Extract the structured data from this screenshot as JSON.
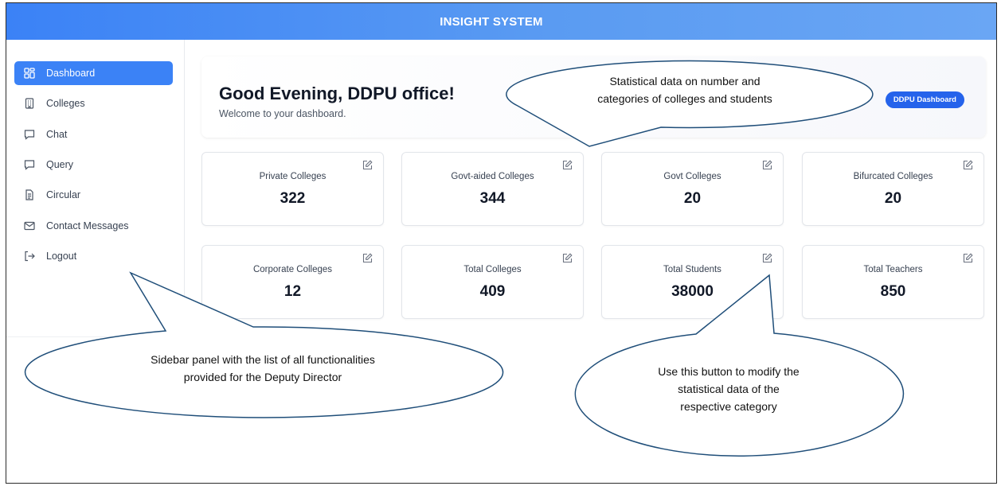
{
  "app": {
    "title": "INSIGHT SYSTEM"
  },
  "sidebar": {
    "items": [
      {
        "label": "Dashboard",
        "icon": "dashboard-icon",
        "active": true
      },
      {
        "label": "Colleges",
        "icon": "building-icon",
        "active": false
      },
      {
        "label": "Chat",
        "icon": "chat-icon",
        "active": false
      },
      {
        "label": "Query",
        "icon": "query-icon",
        "active": false
      },
      {
        "label": "Circular",
        "icon": "document-icon",
        "active": false
      },
      {
        "label": "Contact Messages",
        "icon": "mail-icon",
        "active": false
      },
      {
        "label": "Logout",
        "icon": "logout-icon",
        "active": false
      }
    ]
  },
  "welcome": {
    "greeting": "Good Evening, DDPU office!",
    "subtitle": "Welcome to your dashboard.",
    "badge": "DDPU Dashboard"
  },
  "stats": [
    {
      "label": "Private Colleges",
      "value": "322"
    },
    {
      "label": "Govt-aided Colleges",
      "value": "344"
    },
    {
      "label": "Govt Colleges",
      "value": "20"
    },
    {
      "label": "Bifurcated Colleges",
      "value": "20"
    },
    {
      "label": "Corporate Colleges",
      "value": "12"
    },
    {
      "label": "Total Colleges",
      "value": "409"
    },
    {
      "label": "Total Students",
      "value": "38000"
    },
    {
      "label": "Total Teachers",
      "value": "850"
    }
  ],
  "annotations": {
    "stats": [
      "Statistical data on number and",
      "categories of colleges and students"
    ],
    "sidebar": [
      "Sidebar panel with the list of all functionalities",
      "provided for the Deputy Director"
    ],
    "edit": [
      "Use this button to modify the",
      "statistical data of the",
      "respective category"
    ]
  },
  "colors": {
    "accent": "#3b82f6",
    "badge": "#2563eb",
    "callout_stroke": "#1f4e79"
  }
}
